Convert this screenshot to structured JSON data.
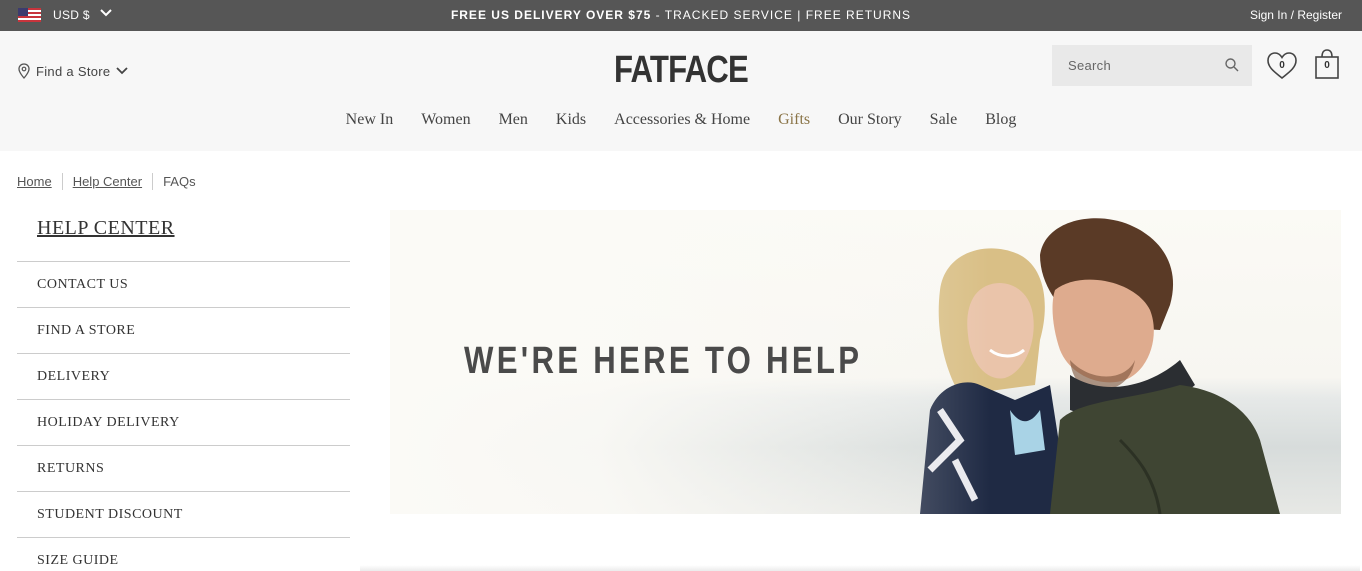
{
  "topbar": {
    "currency": "USD $",
    "promo_bold": "FREE US DELIVERY OVER $75",
    "promo_rest": " - TRACKED SERVICE | FREE RETURNS",
    "signin": "Sign In / Register"
  },
  "header": {
    "find_store": "Find a Store",
    "logo": "FATFACE",
    "search_placeholder": "Search",
    "wishlist_count": "0",
    "bag_count": "0"
  },
  "nav": {
    "items": [
      "New In",
      "Women",
      "Men",
      "Kids",
      "Accessories & Home",
      "Gifts",
      "Our Story",
      "Sale",
      "Blog"
    ]
  },
  "breadcrumb": {
    "items": [
      "Home",
      "Help Center",
      "FAQs"
    ]
  },
  "sidebar": {
    "title": "HELP CENTER",
    "items": [
      "CONTACT US",
      "FIND A STORE",
      "DELIVERY",
      "HOLIDAY DELIVERY",
      "RETURNS",
      "STUDENT DISCOUNT",
      "SIZE GUIDE"
    ]
  },
  "hero": {
    "title": "WE'RE HERE TO HELP"
  },
  "colors": {
    "topbar_bg": "#565656",
    "header_bg": "#f7f7f7",
    "gifts_accent": "#8a7447",
    "search_bg": "#e9e9e9"
  },
  "icons": [
    "us-flag-icon",
    "chevron-down-icon",
    "location-pin-icon",
    "search-icon",
    "heart-icon",
    "shopping-bag-icon"
  ]
}
